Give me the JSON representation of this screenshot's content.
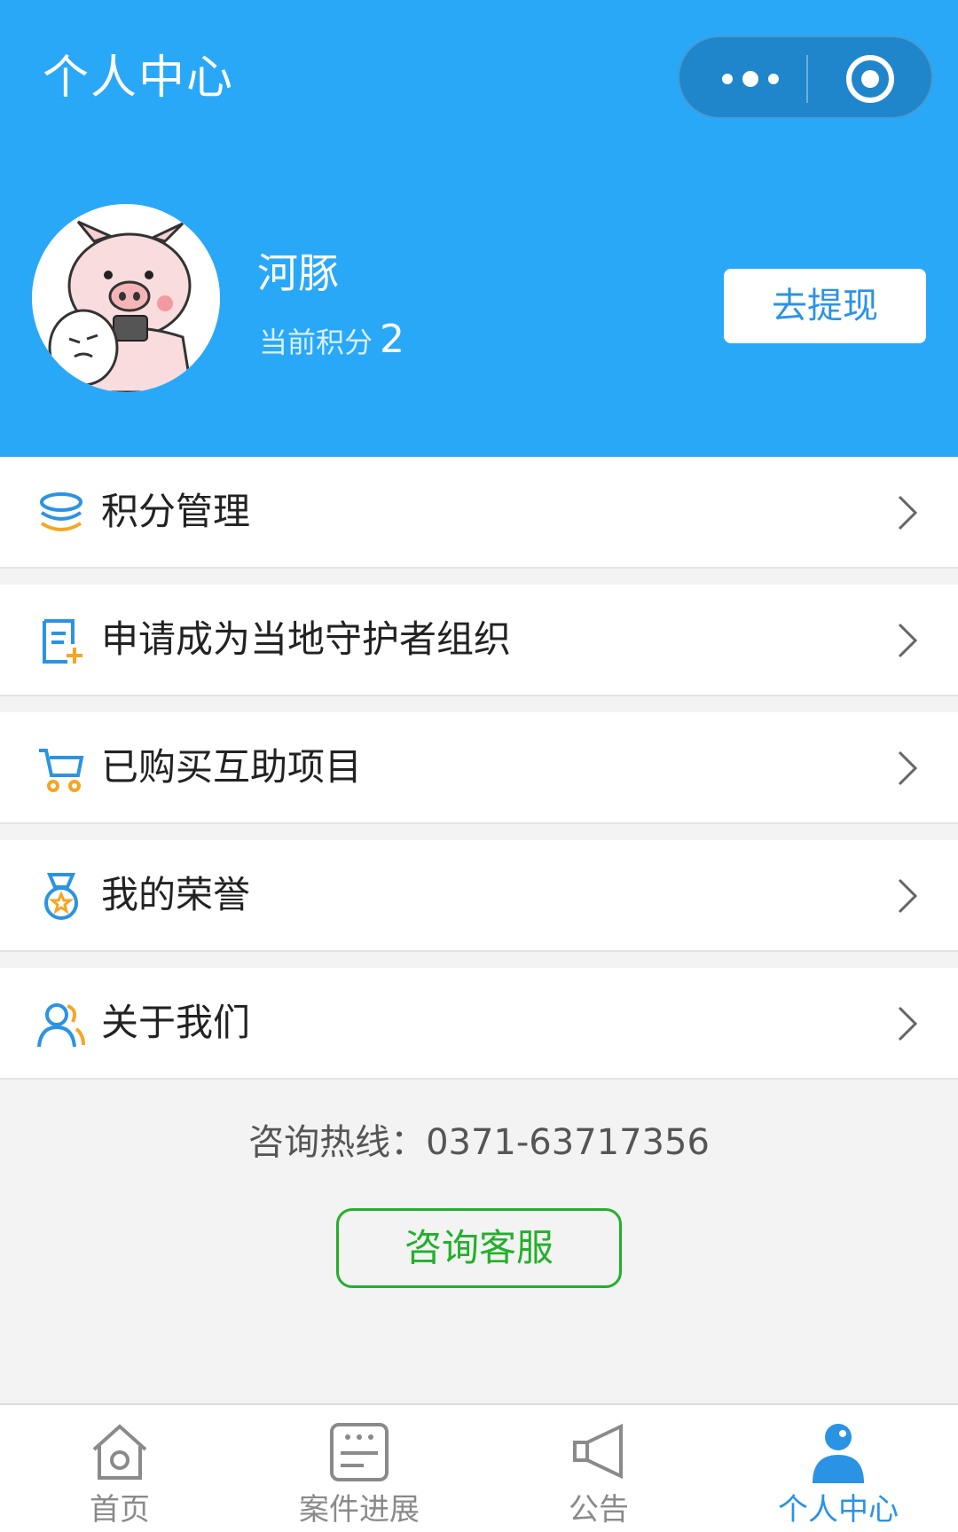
{
  "header": {
    "title": "个人中心",
    "capsule": {
      "more_icon": "more-dots-icon",
      "close_icon": "target-close-icon"
    }
  },
  "profile": {
    "name": "河豚",
    "points_label": "当前积分",
    "points_value": "2",
    "withdraw_label": "去提现"
  },
  "menu": {
    "items": [
      {
        "label": "积分管理",
        "icon": "coins-stack-icon"
      },
      {
        "label": "申请成为当地守护者组织",
        "icon": "document-add-icon"
      },
      {
        "label": "已购买互助项目",
        "icon": "shopping-cart-icon"
      },
      {
        "label": "我的荣誉",
        "icon": "medal-icon"
      },
      {
        "label": "关于我们",
        "icon": "users-icon"
      }
    ]
  },
  "footer": {
    "hotline": "咨询热线：0371-63717356",
    "consult_label": "咨询客服"
  },
  "tabbar": {
    "items": [
      {
        "label": "首页",
        "icon": "home-icon",
        "active": false
      },
      {
        "label": "案件进展",
        "icon": "case-board-icon",
        "active": false
      },
      {
        "label": "公告",
        "icon": "megaphone-icon",
        "active": false
      },
      {
        "label": "个人中心",
        "icon": "person-icon",
        "active": true
      }
    ]
  },
  "colors": {
    "header_bg": "#2aa8f8",
    "accent_blue": "#2a93e4",
    "accent_green": "#22b02a",
    "icon_orange": "#f5a623"
  }
}
